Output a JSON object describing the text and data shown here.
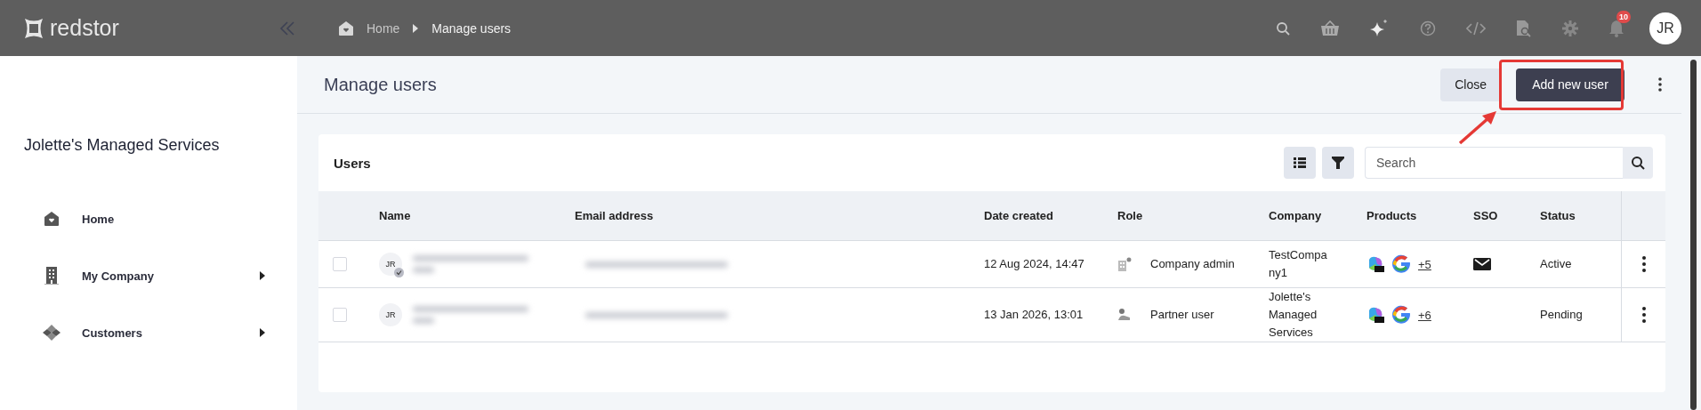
{
  "topbar": {
    "logo": "redstor",
    "breadcrumb": [
      "Home",
      "Manage users"
    ],
    "notifications": "10",
    "avatar": "JR"
  },
  "sidebar": {
    "company": "Jolette's Managed Services",
    "items": [
      {
        "label": "Home",
        "kind": "home",
        "expandable": false
      },
      {
        "label": "My Company",
        "kind": "building",
        "expandable": true
      },
      {
        "label": "Customers",
        "kind": "customers",
        "expandable": true
      }
    ]
  },
  "page": {
    "title": "Manage users",
    "buttons": [
      "Close",
      "Add new user"
    ]
  },
  "card": {
    "title": "Users",
    "search": {
      "placeholder": "Search"
    },
    "columns": [
      "Name",
      "Email address",
      "Date created",
      "Role",
      "Company",
      "Products",
      "SSO",
      "Status"
    ],
    "rows": [
      {
        "checked": false,
        "avatar": "JR",
        "verified": true,
        "date": "12 Aug 2024, 14:47",
        "role": {
          "kind": "company",
          "text": "Company admin"
        },
        "company": "TestCompany1",
        "products_more": "+5",
        "sso": true,
        "status": "Active"
      },
      {
        "checked": false,
        "avatar": "JR",
        "verified": false,
        "date": "13 Jan 2026, 13:01",
        "role": {
          "kind": "partner",
          "text": "Partner user"
        },
        "company": "Jolette's Managed Services",
        "products_more": "+6",
        "sso": false,
        "status": "Pending"
      }
    ]
  }
}
